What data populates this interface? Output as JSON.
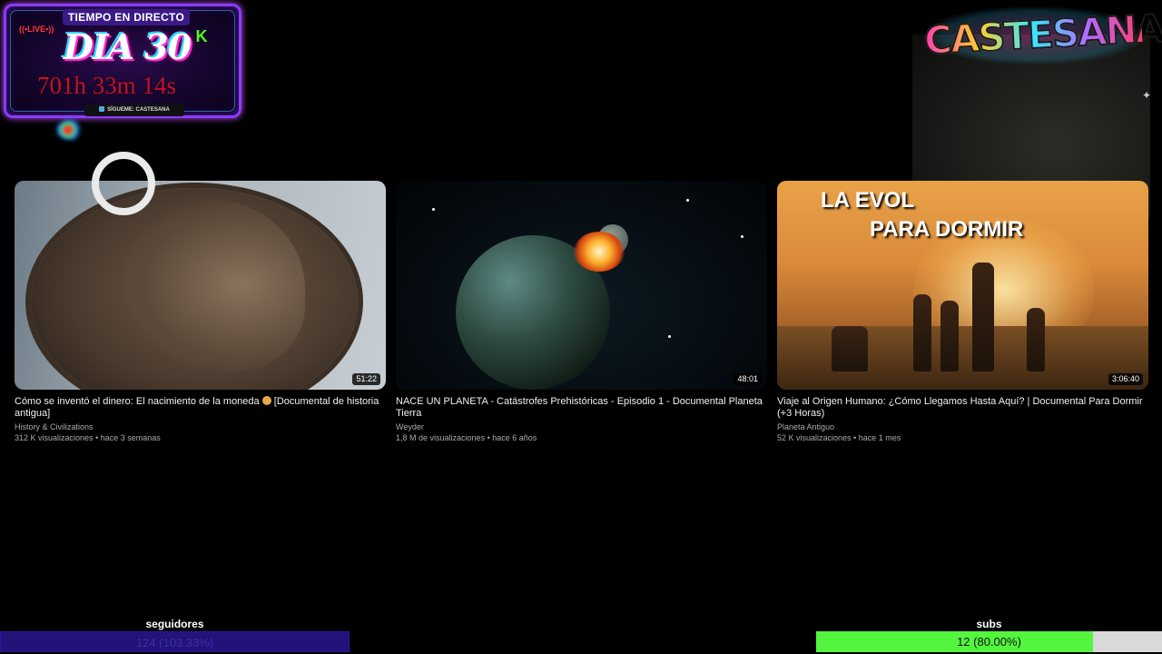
{
  "overlay": {
    "header": "TIEMPO EN DIRECTO",
    "live_badge": "((•LIVE•))",
    "day": "DIA 30",
    "kick_icon": "K",
    "uptime": "701h 33m 14s",
    "follow_text": "SÍGUEME: CASTESANA",
    "logo": "CASTESANA"
  },
  "videos": [
    {
      "title": "Cómo se inventó el dinero: El nacimiento de la moneda",
      "title_suffix": "[Documental de historia antigua]",
      "channel": "History & Civilizations",
      "views": "312 K visualizaciones",
      "age": "hace 3 semanas",
      "duration": "51:22"
    },
    {
      "title": "NACE UN PLANETA - Catástrofes Prehistóricas - Episodio 1 - Documental Planeta Tierra",
      "channel": "Weyder",
      "views": "1,8 M de visualizaciones",
      "age": "hace 6 años",
      "duration": "48:01"
    },
    {
      "title": "Viaje al Origen Humano: ¿Cómo Llegamos Hasta Aquí? | Documental Para Dormir (+3 Horas)",
      "channel": "Planeta Antiguo",
      "views": "52 K visualizaciones",
      "age": "hace 1 mes",
      "duration": "3:06:40",
      "thumb_text_1": "LA EVOL",
      "thumb_text_2": "PARA DORMIR"
    }
  ],
  "meta_separator": " • ",
  "goals": {
    "followers": {
      "label": "seguidores",
      "text": "124 (103.33%)",
      "progress": 1.0
    },
    "subs": {
      "label": "subs",
      "text": "12 (80.00%)",
      "progress": 0.8
    }
  },
  "colors": {
    "followers_fill": "#22127a",
    "subs_fill": "#53f53f",
    "panel_border": "#8a3cff",
    "uptime_color": "#c8102e"
  }
}
